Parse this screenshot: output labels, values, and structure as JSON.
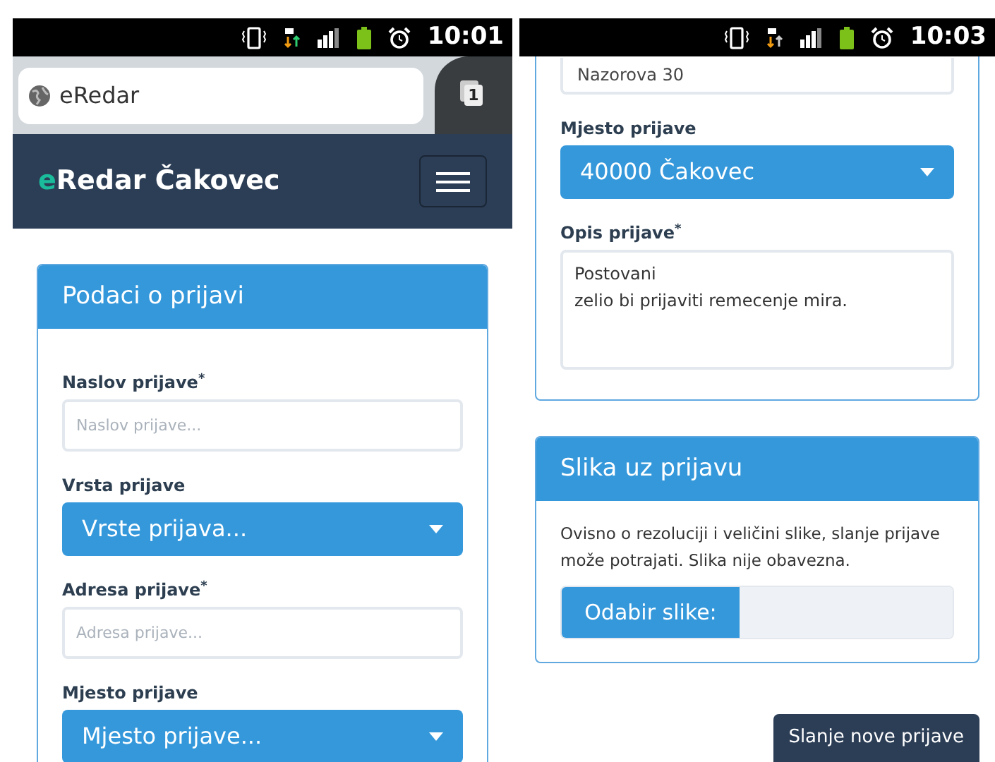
{
  "left_screen": {
    "status_bar": {
      "time": "10:01"
    },
    "browser": {
      "url": "eRedar",
      "tab_count": "1"
    },
    "navbar": {
      "brand_accent": "e",
      "brand": "Redar Čakovec"
    },
    "form_card": {
      "title": "Podaci o prijavi",
      "fields": [
        {
          "kind": "input",
          "label": "Naslov prijave$^{*}$",
          "placeholder": "Naslov prijave..."
        },
        {
          "kind": "select",
          "label": "Vrsta prijave",
          "value": "Vrste prijava..."
        },
        {
          "kind": "input",
          "label": "Adresa prijave$^{*}$",
          "placeholder": "Adresa prijave..."
        },
        {
          "kind": "select",
          "label": "Mjesto prijave",
          "value": "Mjesto prijave..."
        }
      ]
    }
  },
  "right_screen": {
    "status_bar": {
      "time": "10:03"
    },
    "form_card": {
      "fields": [
        {
          "kind": "input",
          "value": "Nazorova 30"
        },
        {
          "kind": "select",
          "label": "Mjesto prijave",
          "value": "40000 Čakovec"
        },
        {
          "kind": "textarea",
          "label": "Opis prijave$^{*}$",
          "value": "Postovani\nzelio bi prijaviti remecenje mira."
        }
      ]
    },
    "image_card": {
      "title": "Slika uz prijavu",
      "text": "Ovisno o rezoluciji i veličini slike, slanje prijave može potrajati. Slika nije obavezna.",
      "file_button": "Odabir slike:"
    },
    "submit_button": "Slanje nove prijave"
  }
}
